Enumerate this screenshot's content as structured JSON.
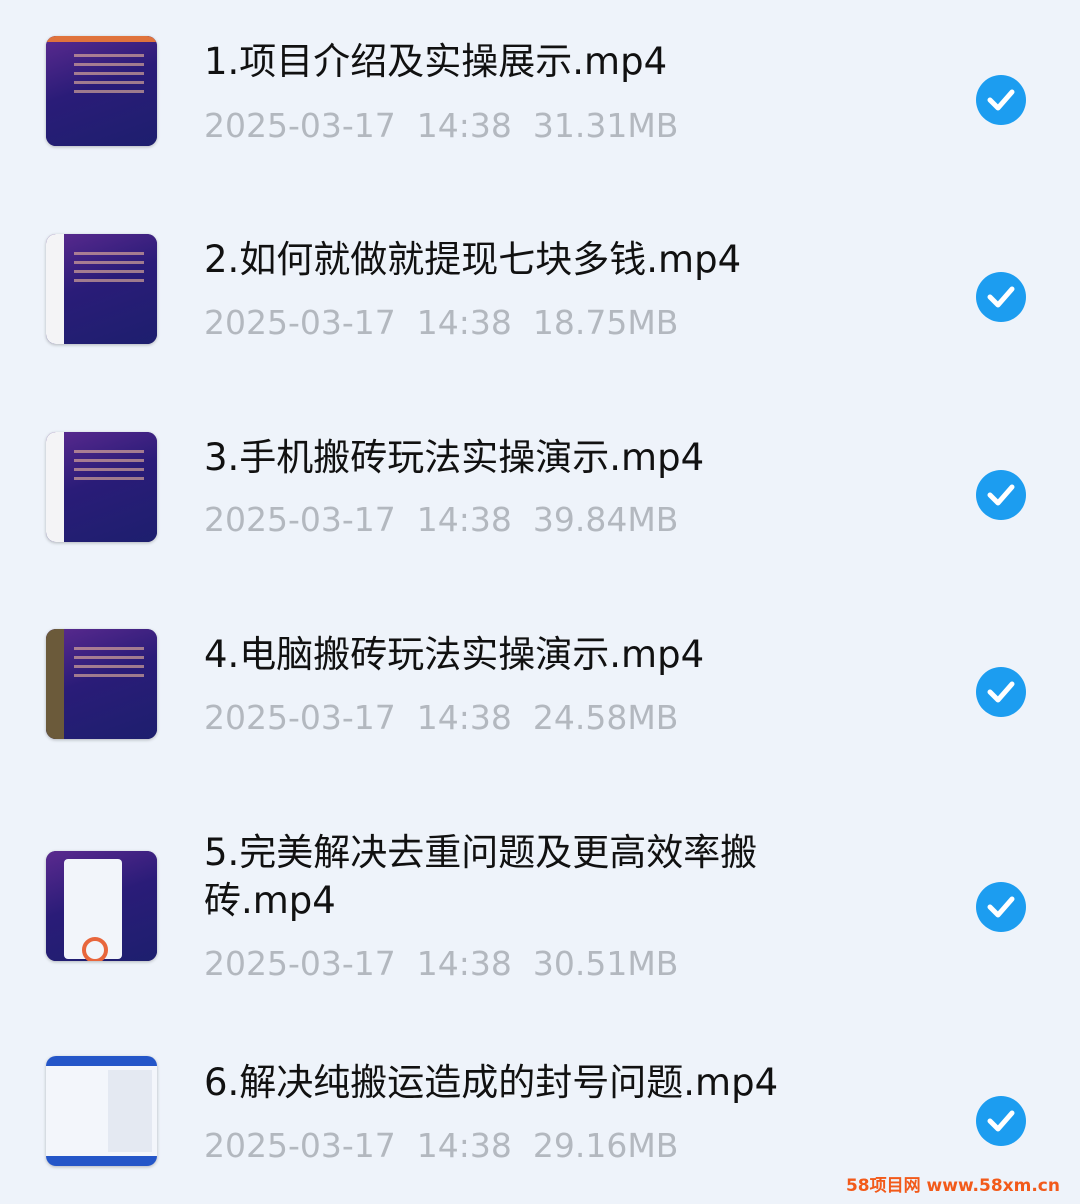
{
  "files": [
    {
      "name": "1.项目介绍及实操展示.mp4",
      "date": "2025-03-17",
      "time": "14:38",
      "size": "31.31MB",
      "selected": true,
      "thumb_icon": "video-thumbnail-icon"
    },
    {
      "name": "2.如何就做就提现七块多钱.mp4",
      "date": "2025-03-17",
      "time": "14:38",
      "size": "18.75MB",
      "selected": true,
      "thumb_icon": "video-thumbnail-icon"
    },
    {
      "name": "3.手机搬砖玩法实操演示.mp4",
      "date": "2025-03-17",
      "time": "14:38",
      "size": "39.84MB",
      "selected": true,
      "thumb_icon": "video-thumbnail-icon"
    },
    {
      "name": "4.电脑搬砖玩法实操演示.mp4",
      "date": "2025-03-17",
      "time": "14:38",
      "size": "24.58MB",
      "selected": true,
      "thumb_icon": "video-thumbnail-icon"
    },
    {
      "name": "5.完美解决去重问题及更高效率搬砖.mp4",
      "date": "2025-03-17",
      "time": "14:38",
      "size": "30.51MB",
      "selected": true,
      "thumb_icon": "video-thumbnail-icon"
    },
    {
      "name": "6.解决纯搬运造成的封号问题.mp4",
      "date": "2025-03-17",
      "time": "14:38",
      "size": "29.16MB",
      "selected": true,
      "thumb_icon": "video-thumbnail-icon"
    }
  ],
  "watermark": "58项目网 www.58xm.cn",
  "colors": {
    "check": "#1c9df0",
    "background": "#eef3fa",
    "meta": "#b3b8bf"
  }
}
